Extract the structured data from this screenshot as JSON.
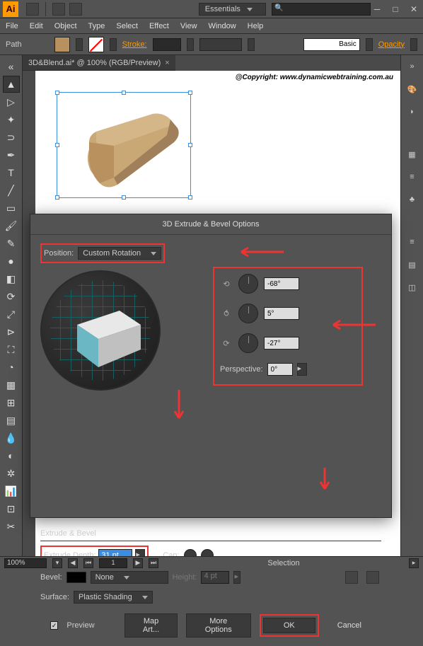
{
  "titlebar": {
    "workspace": "Essentials"
  },
  "menu": {
    "file": "File",
    "edit": "Edit",
    "object": "Object",
    "type": "Type",
    "select": "Select",
    "effect": "Effect",
    "view": "View",
    "window": "Window",
    "help": "Help"
  },
  "optbar": {
    "context": "Path",
    "stroke_label": "Stroke:",
    "brush_label": "Basic",
    "opacity_label": "Opacity"
  },
  "doc": {
    "tab": "3D&Blend.ai* @ 100% (RGB/Preview)",
    "copyright": "@Copyright: www.dynamicwebtraining.com.au"
  },
  "dialog": {
    "title": "3D Extrude & Bevel Options",
    "position_label": "Position:",
    "position_value": "Custom Rotation",
    "rot_x": "-68°",
    "rot_y": "5°",
    "rot_z": "-27°",
    "perspective_label": "Perspective:",
    "perspective_value": "0°",
    "extrude_header": "Extrude & Bevel",
    "extrude_depth_label": "Extrude Depth:",
    "extrude_depth_value": "31 pt",
    "cap_label": "Cap:",
    "bevel_label": "Bevel:",
    "bevel_value": "None",
    "height_label": "Height:",
    "height_value": "4 pt",
    "surface_label": "Surface:",
    "surface_value": "Plastic Shading",
    "preview_label": "Preview",
    "map_art": "Map Art...",
    "more_opts": "More Options",
    "ok": "OK",
    "cancel": "Cancel"
  },
  "status": {
    "zoom": "100%",
    "mode": "Selection"
  },
  "colors": {
    "fill": "#b8915f",
    "accent": "#e33",
    "select": "#3b8de0"
  }
}
